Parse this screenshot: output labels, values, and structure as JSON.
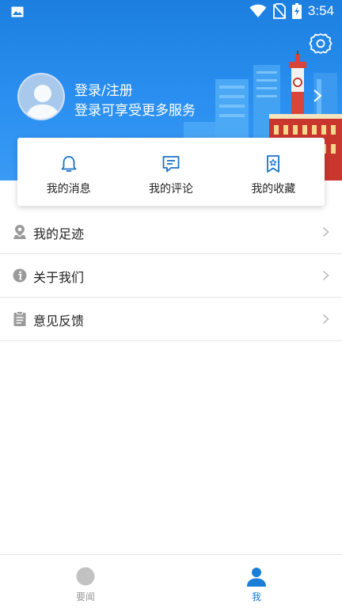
{
  "status_bar": {
    "time": "3:54",
    "icons": [
      "image-icon",
      "wifi-icon",
      "no-sim-icon",
      "battery-charging-icon"
    ]
  },
  "header": {
    "login_title": "登录/注册",
    "login_subtitle": "登录可享受更多服务",
    "settings_icon": "gear-icon",
    "background_color": "#1c7fe0"
  },
  "quick_actions": [
    {
      "label": "我的消息",
      "icon": "bell-icon"
    },
    {
      "label": "我的评论",
      "icon": "comment-icon"
    },
    {
      "label": "我的收藏",
      "icon": "bookmark-star-icon"
    }
  ],
  "menu": [
    {
      "label": "我的足迹",
      "icon": "location-pin-icon"
    },
    {
      "label": "关于我们",
      "icon": "info-icon"
    },
    {
      "label": "意见反馈",
      "icon": "clipboard-icon"
    }
  ],
  "tab_bar": {
    "tabs": [
      {
        "label": "要闻",
        "icon": "circle-icon",
        "active": false
      },
      {
        "label": "我",
        "icon": "person-icon",
        "active": true
      }
    ],
    "active_color": "#1a7ed6",
    "inactive_color": "#999999"
  },
  "colors": {
    "accent": "#1a7ed6",
    "icon_blue": "#1a73c8",
    "menu_icon_gray": "#9a9a9a"
  }
}
